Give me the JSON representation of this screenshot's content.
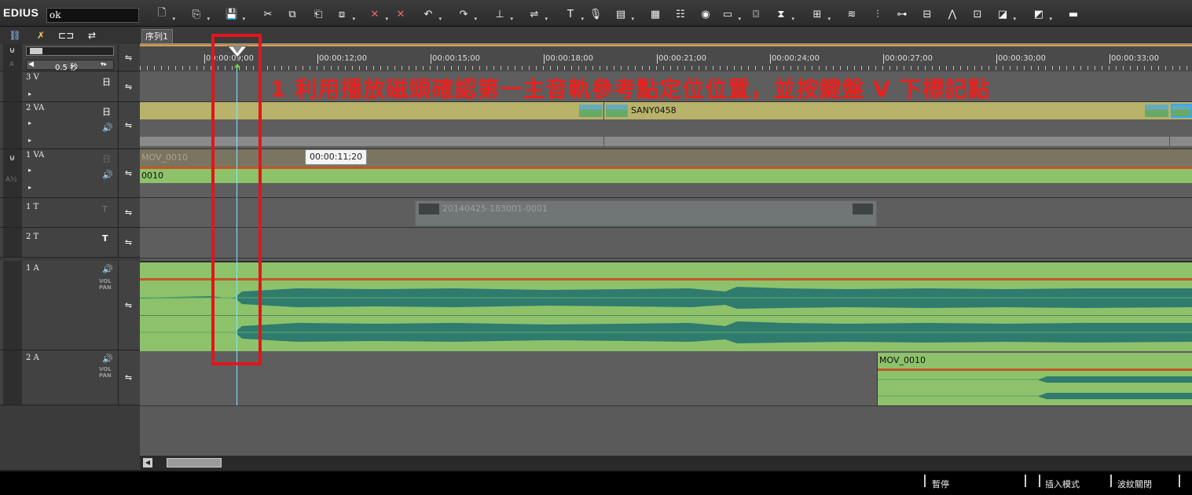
{
  "app": {
    "name": "EDIUS",
    "project_name": "ok"
  },
  "sequence_tab": "序列1",
  "zoom": {
    "label": "0.5 秒"
  },
  "ruler": {
    "ticks": [
      "00:00:09;00",
      "00:00:12;00",
      "00:00:15;00",
      "00:00:18;00",
      "00:00:21;00",
      "00:00:24;00",
      "00:00:27;00",
      "00:00:30;00",
      "00:00:33;00"
    ]
  },
  "tracks": [
    {
      "name": "3 V"
    },
    {
      "name": "2 VA"
    },
    {
      "name": "1 VA"
    },
    {
      "name": "1 T"
    },
    {
      "name": "2 T"
    },
    {
      "name": "1 A"
    },
    {
      "name": "2 A"
    }
  ],
  "vol_pan": {
    "vol": "VOL",
    "pan": "PAN"
  },
  "a_label": "A",
  "a12_label": "A½",
  "clips": {
    "sany": "SANY0458",
    "mov_faded": "MOV_0010",
    "mov_audio_tail": "0010",
    "title_clip": "20140425-183001-0001",
    "a2_clip": "MOV_0010"
  },
  "tooltip": "00:00:11;20",
  "annotation": "1  利用播放磁頭確認第一主音軌參考點定位位置，並按鍵盤 V 下標記點",
  "status": {
    "pause": "暫停",
    "insert_mode": "插入模式",
    "ripple": "波紋關閉"
  },
  "colors": {
    "annotation": "#e8211e",
    "playhead": "#7fe9ff",
    "clip_video": "#b8b26a",
    "clip_audio": "#8dc26a",
    "waveform": "#2f7b6e"
  }
}
